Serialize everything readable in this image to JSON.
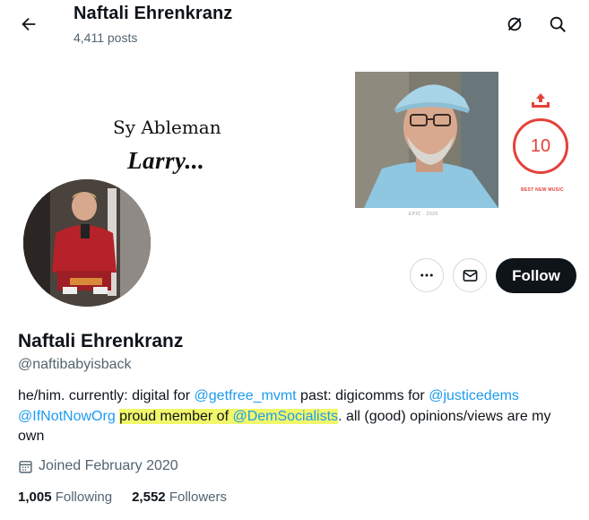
{
  "header": {
    "title": "Naftali Ehrenkranz",
    "post_count": "4,411 posts",
    "back_icon": "arrow-left-icon",
    "grok_icon": "grok-icon",
    "search_icon": "search-icon"
  },
  "banner": {
    "text_line1": "Sy Ableman",
    "text_line2": "Larry...",
    "photo_caption": "EPIC · 2020",
    "score": "10",
    "score_label": "BEST NEW MUSIC",
    "score_color": "#e5413a"
  },
  "actions": {
    "more_icon": "more-icon",
    "message_icon": "envelope-icon",
    "follow_label": "Follow"
  },
  "profile": {
    "display_name": "Naftali Ehrenkranz",
    "handle": "@naftibabyisback",
    "bio": {
      "part1": "he/him. currently: digital for ",
      "link1": "@getfree_mvmt",
      "part2": " past: digicomms for ",
      "link2": "@justicedems",
      "part3": " ",
      "link3": "@IfNotNowOrg",
      "part4": " ",
      "highlight_text": "proud member of ",
      "link4": "@DemSocialists",
      "part5": ". all (good) opinions/views are my own"
    },
    "joined": "Joined February 2020",
    "following_count": "1,005",
    "following_label": "Following",
    "followers_count": "2,552",
    "followers_label": "Followers",
    "link_color": "#1d9bf0",
    "highlight_color": "#f1f76a"
  }
}
